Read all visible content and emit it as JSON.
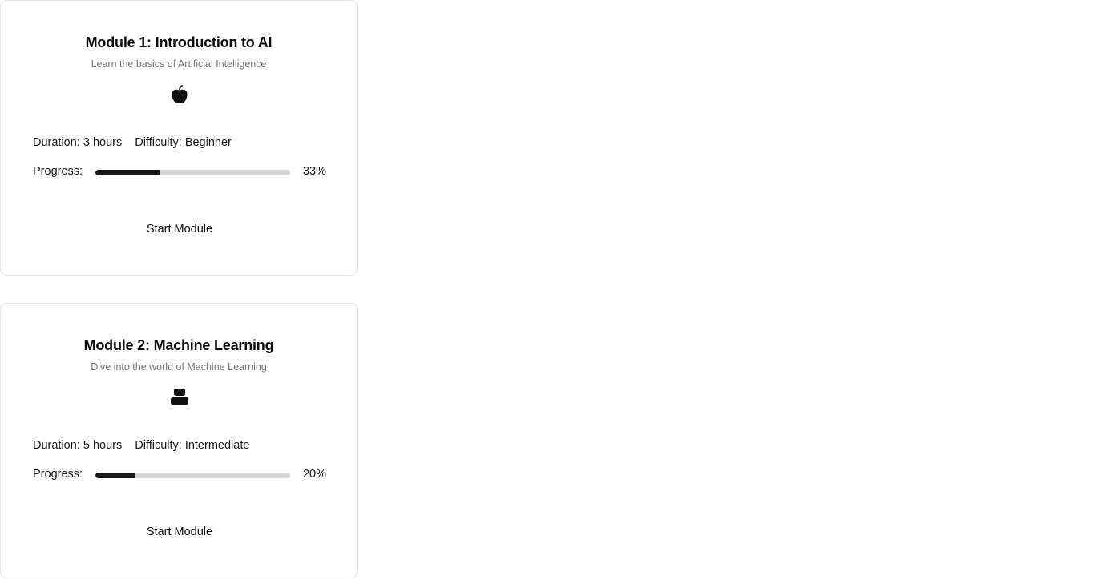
{
  "modules": [
    {
      "title": "Module 1: Introduction to AI",
      "subtitle": "Learn the basics of Artificial Intelligence",
      "icon": "apple-icon",
      "duration": "Duration: 3 hours",
      "difficulty": "Difficulty: Beginner",
      "progress_label": "Progress:",
      "progress_value": 33,
      "progress_text": "33%",
      "button_label": "Start Module"
    },
    {
      "title": "Module 2: Machine Learning",
      "subtitle": "Dive into the world of Machine Learning",
      "icon": "stack-icon",
      "duration": "Duration: 5 hours",
      "difficulty": "Difficulty: Intermediate",
      "progress_label": "Progress:",
      "progress_value": 20,
      "progress_text": "20%",
      "button_label": "Start Module"
    }
  ],
  "colors": {
    "progress_fill": "#18181b",
    "progress_track": "#d4d4d4",
    "card_border": "#e4e4e7",
    "subtitle": "#71717a"
  }
}
